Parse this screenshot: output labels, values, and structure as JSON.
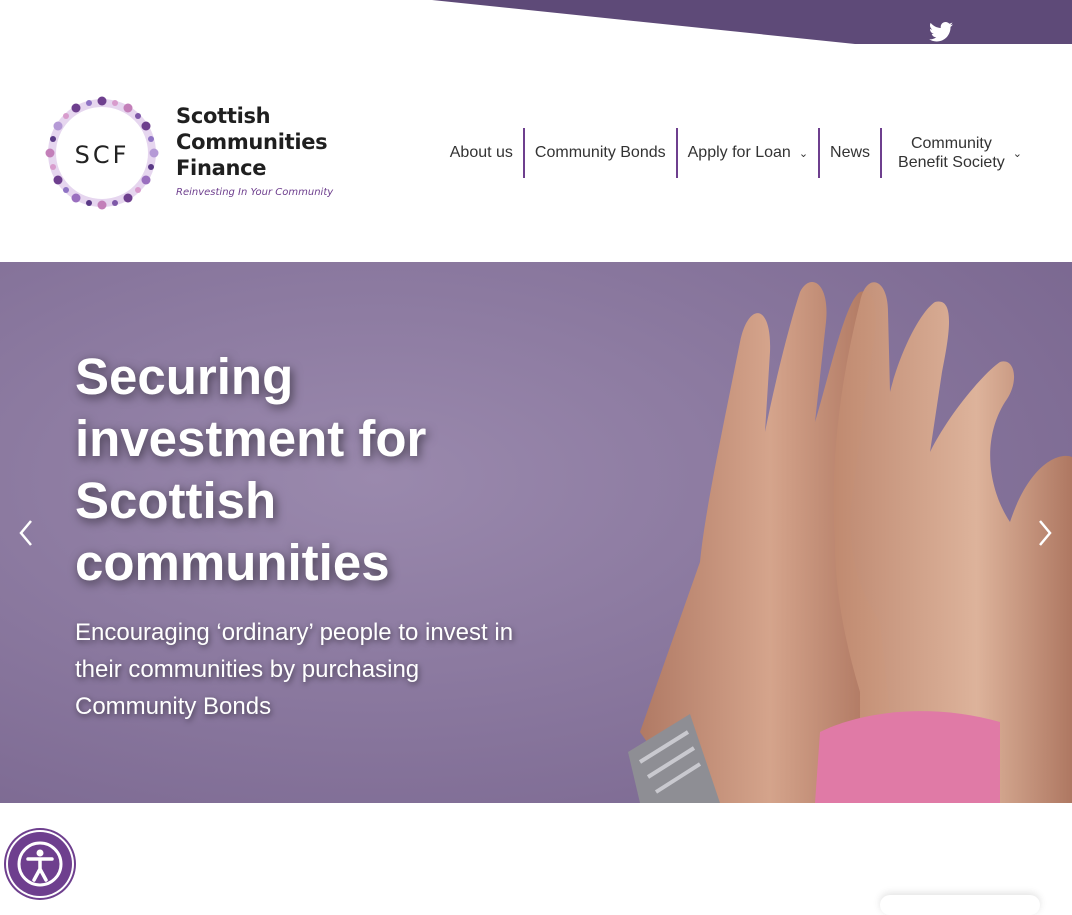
{
  "brand": {
    "logo_initials": "SCF",
    "line1": "Scottish",
    "line2": "Communities",
    "line3": "Finance",
    "tagline": "Reinvesting In Your Community"
  },
  "social": {
    "twitter_icon": "twitter-bird-icon"
  },
  "nav": {
    "items": [
      {
        "label": "About us"
      },
      {
        "label": "Community Bonds"
      },
      {
        "label": "Apply for Loan",
        "has_dropdown": true
      },
      {
        "label": "News"
      },
      {
        "label_line1": "Community",
        "label_line2": "Benefit Society",
        "has_dropdown": true
      }
    ]
  },
  "hero": {
    "title": "Securing investment for Scottish communities",
    "subtitle": "Encouraging ‘ordinary’ people to invest in their communities by purchasing Community Bonds",
    "prev_icon": "chevron-left-icon",
    "next_icon": "chevron-right-icon"
  },
  "accessibility": {
    "icon": "accessibility-person-icon"
  },
  "colors": {
    "brand_purple": "#6e3f8e",
    "band_purple": "#5e4a78",
    "hero_purple": "#86749b"
  }
}
